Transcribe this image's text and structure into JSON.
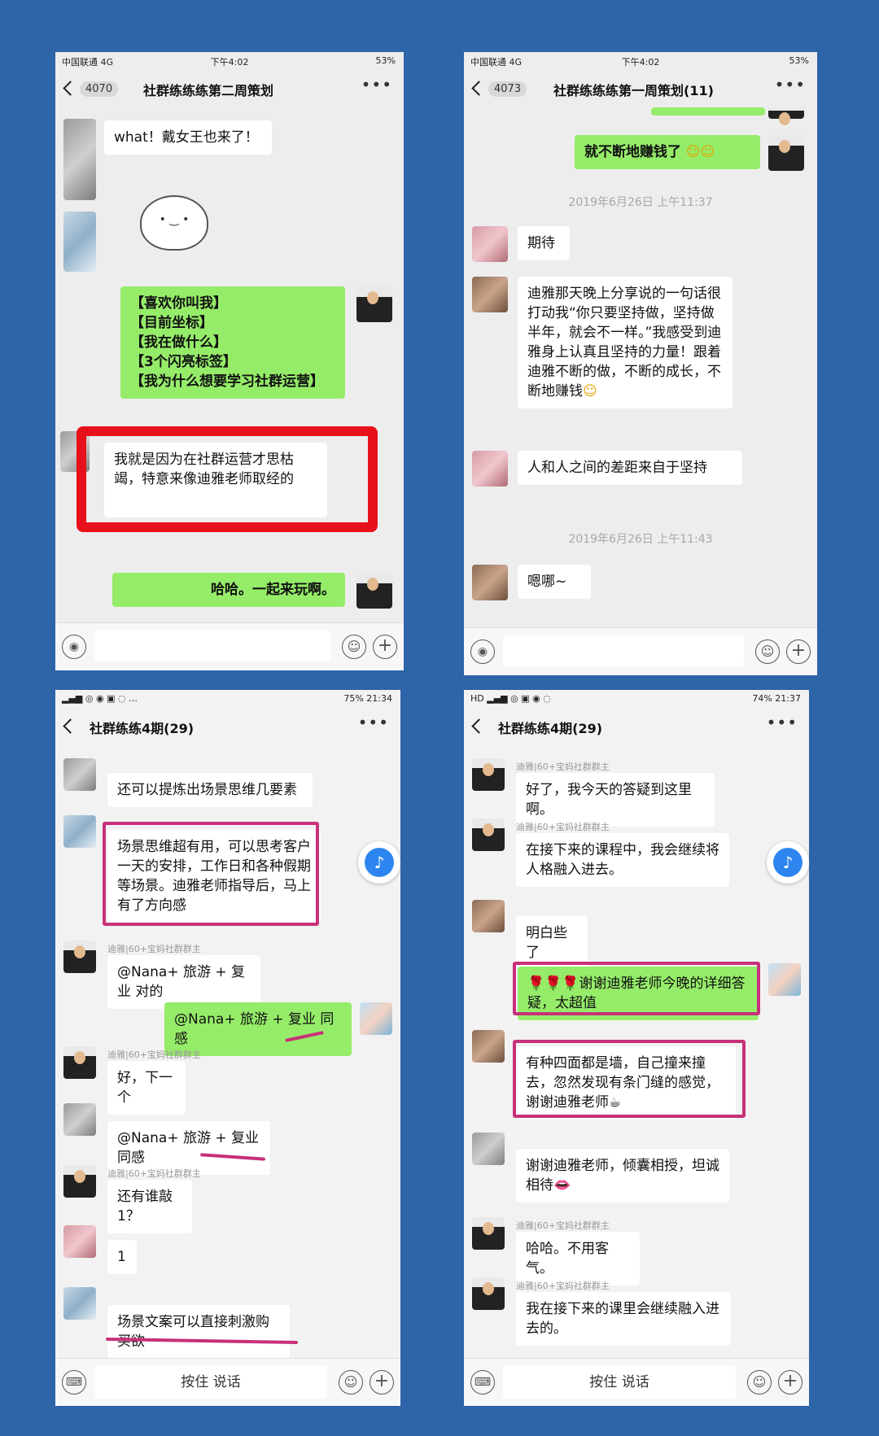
{
  "screen1": {
    "status": {
      "carrier": "中国联通 4G",
      "time": "下午4:02",
      "battery": "53%"
    },
    "badge": "4070",
    "title": "社群练练练第二周策划",
    "messages": {
      "m1": "what！戴女王也来了！",
      "m2": "【喜欢你叫我】\n【目前坐标】\n【我在做什么】\n【3个闪亮标签】\n【我为什么想要学习社群运营】",
      "m3": "我就是因为在社群运营才思枯竭，特意来像迪雅老师取经的",
      "m4": "哈哈。一起来玩啊。"
    }
  },
  "screen2": {
    "status": {
      "carrier": "中国联通 4G",
      "time": "下午4:02",
      "battery": "53%"
    },
    "badge": "4073",
    "title": "社群练练练第一周策划(11)",
    "messages": {
      "m1": "就不断地赚钱了",
      "t1": "2019年6月26日 上午11:37",
      "m2": "期待",
      "m3": "迪雅那天晚上分享说的一句话很打动我“你只要坚持做，坚持做半年，就会不一样。”我感受到迪雅身上认真且坚持的力量！跟着迪雅不断的做，不断的成长，不断地赚钱",
      "m4": "人和人之间的差距来自于坚持",
      "t2": "2019年6月26日 上午11:43",
      "m5": "嗯哪~"
    }
  },
  "screen3": {
    "status": {
      "right": "75% 21:34"
    },
    "title": "社群练练4期(29)",
    "sender_host": "迪雅|60+宝妈社群群主",
    "messages": {
      "m1": "还可以提炼出场景思维几要素",
      "m2": "场景思维超有用，可以思考客户一天的安排，工作日和各种假期等场景。迪雅老师指导后，马上有了方向感",
      "m3": "@Nana+ 旅游 + 复业 对的",
      "m4": "@Nana+ 旅游 + 复业  同感",
      "m5": "好，下一个",
      "m6": "@Nana+ 旅游 + 复业  同感",
      "m7": "还有谁敲 1？",
      "m8": "1",
      "m9": "场景文案可以直接刺激购买欲"
    },
    "hold_to_talk": "按住 说话"
  },
  "screen4": {
    "status": {
      "right": "74% 21:37"
    },
    "title": "社群练练4期(29)",
    "sender_host": "迪雅|60+宝妈社群群主",
    "messages": {
      "m1": "好了，我今天的答疑到这里啊。",
      "m2": "在接下来的课程中，我会继续将人格融入进去。",
      "m3": "明白些了",
      "m4": "🌹🌹🌹谢谢迪雅老师今晚的详细答疑，太超值",
      "m5": "有种四面都是墙，自己撞来撞去，忽然发现有条门缝的感觉，谢谢迪雅老师☕",
      "m6": "谢谢迪雅老师，倾囊相授，坦诚相待👄",
      "m7": "哈哈。不用客气。",
      "m8": "我在接下来的课里会继续融入进去的。"
    },
    "hold_to_talk": "按住 说话"
  }
}
